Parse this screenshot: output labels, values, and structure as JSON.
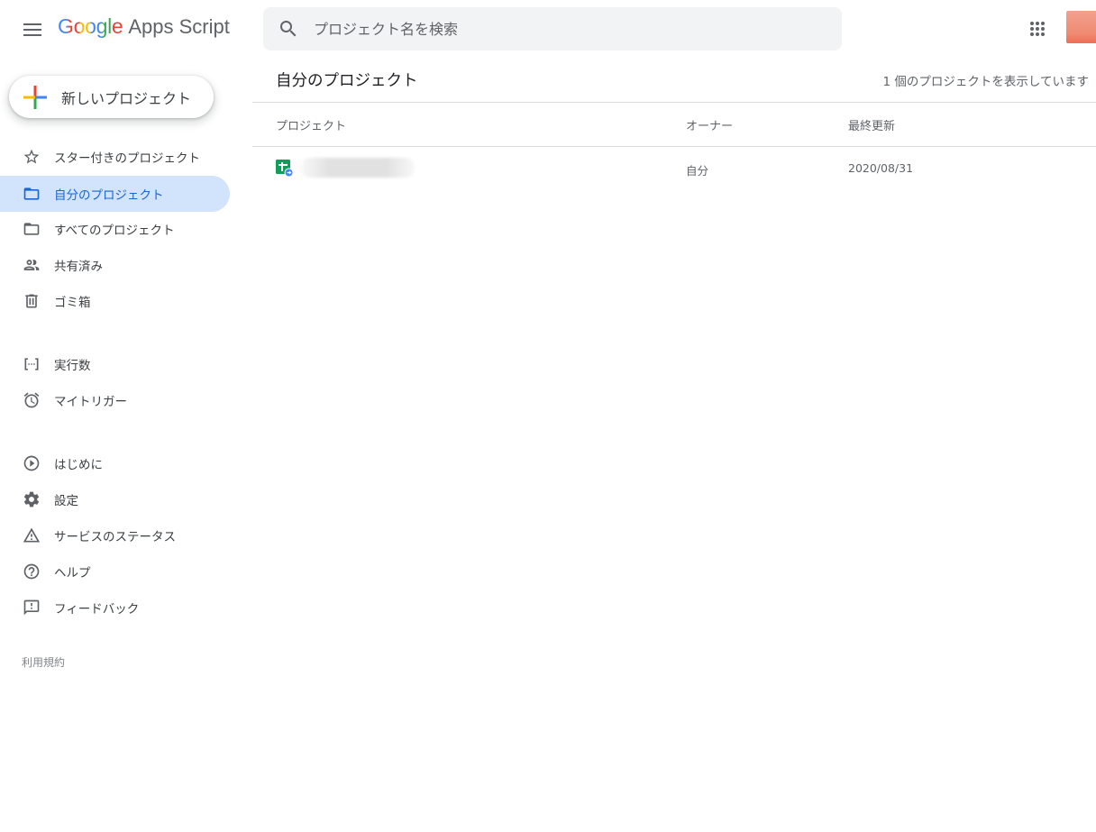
{
  "header": {
    "logo_google": "Google",
    "logo_product": "Apps Script",
    "search_placeholder": "プロジェクト名を検索"
  },
  "new_project_label": "新しいプロジェクト",
  "sidebar": {
    "items": [
      {
        "label": "スター付きのプロジェクト",
        "icon": "star-icon"
      },
      {
        "label": "自分のプロジェクト",
        "icon": "folder-icon",
        "active": true
      },
      {
        "label": "すべてのプロジェクト",
        "icon": "folder-icon"
      },
      {
        "label": "共有済み",
        "icon": "people-icon"
      },
      {
        "label": "ゴミ箱",
        "icon": "trash-icon"
      },
      {
        "label": "実行数",
        "icon": "executions-icon"
      },
      {
        "label": "マイトリガー",
        "icon": "alarm-icon"
      },
      {
        "label": "はじめに",
        "icon": "play-circle-icon"
      },
      {
        "label": "設定",
        "icon": "gear-icon"
      },
      {
        "label": "サービスのステータス",
        "icon": "warning-icon"
      },
      {
        "label": "ヘルプ",
        "icon": "help-icon"
      },
      {
        "label": "フィードバック",
        "icon": "feedback-icon"
      }
    ],
    "terms": "利用規約"
  },
  "main": {
    "title": "自分のプロジェクト",
    "count_text": "1 個のプロジェクトを表示しています",
    "columns": [
      "プロジェクト",
      "オーナー",
      "最終更新"
    ],
    "rows": [
      {
        "name": "",
        "owner": "自分",
        "updated": "2020/08/31"
      }
    ]
  },
  "colors": {
    "accent": "#1a73e8",
    "active_bg": "#d2e3fc",
    "active_text": "#1967d2",
    "search_bg": "#f1f3f4",
    "divider": "#dadce0"
  }
}
